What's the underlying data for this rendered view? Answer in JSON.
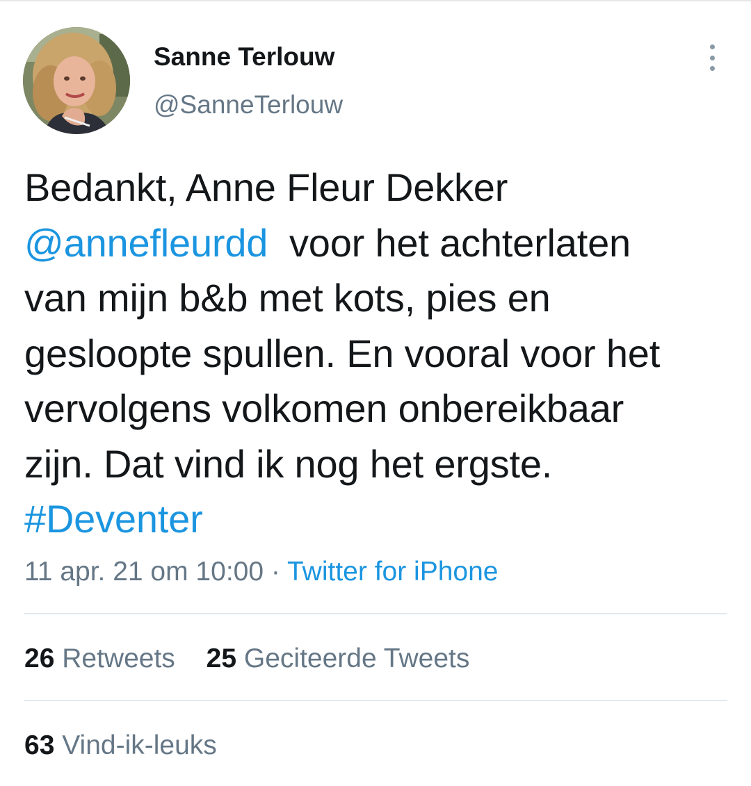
{
  "author": {
    "display_name": "Sanne Terlouw",
    "handle": "@SanneTerlouw",
    "avatar_icon": "profile-photo"
  },
  "menu": {
    "icon": "more-vertical-icon"
  },
  "tweet": {
    "line1": "Bedankt, Anne Fleur Dekker",
    "mention": "@annefleurdd",
    "line2_rest": "voor het achterlaten",
    "line3": "van mijn b&b met kots, pies en",
    "line4": "gesloopte spullen. En vooral voor het",
    "line5": "vervolgens volkomen onbereikbaar",
    "line6": "zijn. Dat vind ik nog het ergste.",
    "hashtag": "#Deventer"
  },
  "meta": {
    "timestamp": "11 apr. 21 om 10:00",
    "separator": "·",
    "source": "Twitter for iPhone"
  },
  "stats": {
    "retweets_count": "26",
    "retweets_label": "Retweets",
    "quotes_count": "25",
    "quotes_label": "Geciteerde Tweets",
    "likes_count": "63",
    "likes_label": "Vind-ik-leuks"
  },
  "colors": {
    "link": "#1b95e0",
    "secondary_text": "#657786",
    "primary_text": "#14171a",
    "divider": "#e1e8ed"
  }
}
